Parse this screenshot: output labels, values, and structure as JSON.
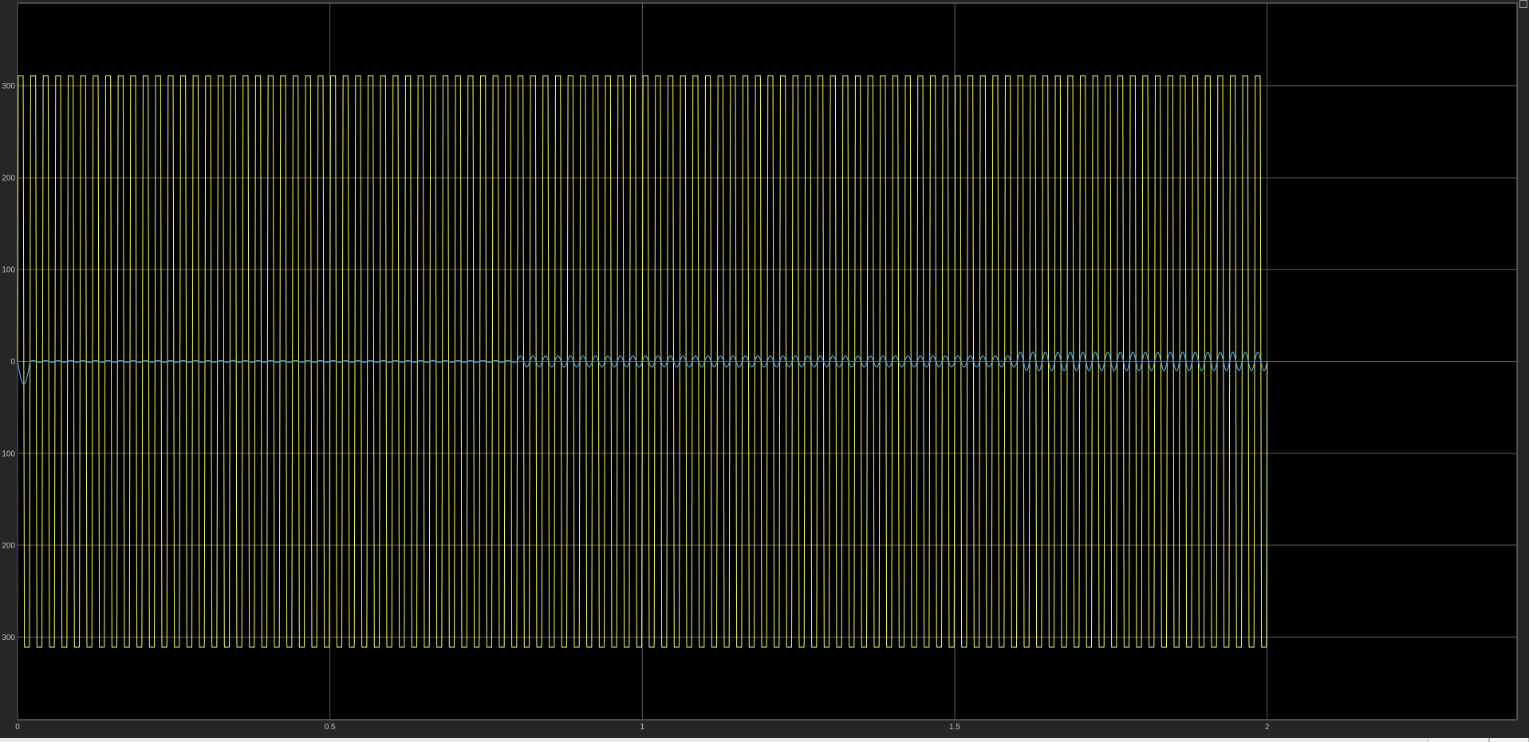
{
  "chart_data": {
    "type": "line",
    "title": "",
    "xlabel": "",
    "ylabel": "",
    "xlim": [
      0,
      2.4
    ],
    "ylim": [
      -390,
      390
    ],
    "grid": true,
    "background": "#000000",
    "grid_color": "#5f5f5f",
    "x_ticks": [
      0,
      0.5,
      1,
      1.5,
      2
    ],
    "x_tick_labels": [
      "0",
      "0.5",
      "1",
      "1.5",
      "2"
    ],
    "y_ticks": [
      300,
      200,
      100,
      0,
      -100,
      -200,
      -300
    ],
    "y_tick_labels": [
      "300",
      "200",
      "100",
      "0",
      "100",
      "200",
      "300"
    ],
    "series": [
      {
        "color": "#ffff66",
        "shape": "square-like wave",
        "amplitude": 311,
        "frequency_hz": 50,
        "t_start": 0,
        "t_end": 2
      },
      {
        "color": "#4fa8e0",
        "shape": "small ripple about zero",
        "frequency_hz": 50,
        "t_start": 0,
        "t_end": 2,
        "initial_dip": -25,
        "ripple": [
          {
            "from": 0.02,
            "to": 0.8,
            "amplitude": 1
          },
          {
            "from": 0.8,
            "to": 1.6,
            "amplitude": 6
          },
          {
            "from": 1.6,
            "to": 2.0,
            "amplitude": 10
          }
        ]
      }
    ]
  }
}
